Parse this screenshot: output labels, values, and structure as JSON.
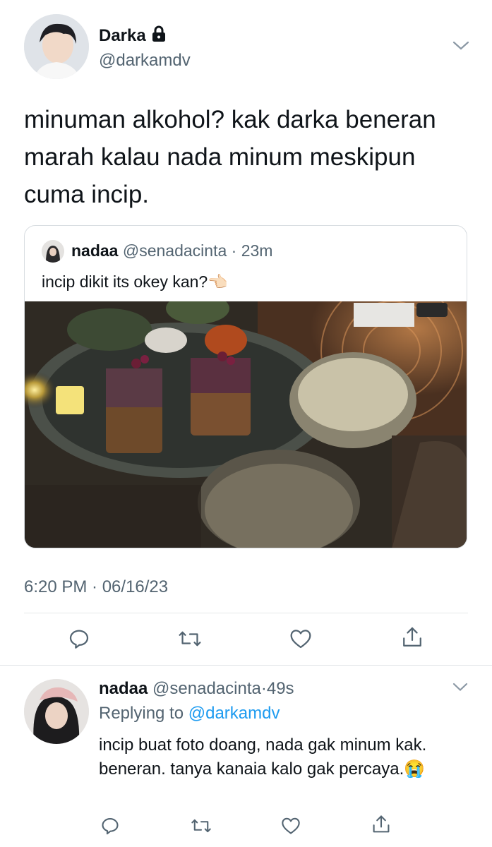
{
  "main_tweet": {
    "author_name": "Darka",
    "lock_icon": "lock-icon",
    "handle": "@darkamdv",
    "text": "minuman alkohol? kak darka beneran marah kalau nada minum meskipun cuma incip.",
    "timestamp": "6:20 PM · 06/16/23",
    "quoted": {
      "author_name": "nadaa",
      "handle": "@senadacinta",
      "sep": "·",
      "time": "23m",
      "text": "incip dikit its okey kan?",
      "emoji": "👈🏻"
    }
  },
  "reply_tweet": {
    "author_name": "nadaa",
    "handle": "@senadacinta",
    "sep": "·",
    "time": "49s",
    "replying_prefix": "Replying to",
    "replying_handle": "@darkamdv",
    "text": "incip buat foto doang, nada gak minum kak. beneran. tanya kanaia kalo gak percaya.",
    "emoji": "😭"
  },
  "icons": {
    "reply": "reply-icon",
    "retweet": "retweet-icon",
    "like": "heart-icon",
    "share": "share-icon",
    "more": "chevron-down-icon"
  },
  "colors": {
    "link": "#1d9bf0",
    "secondary_text": "#536471",
    "primary_text": "#0f1419"
  }
}
